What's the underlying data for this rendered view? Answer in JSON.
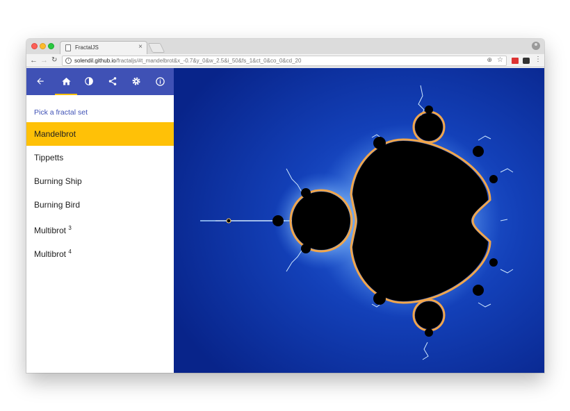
{
  "browser": {
    "tab_title": "FractalJS",
    "tab_close": "×",
    "url_host": "solendil.github.io",
    "url_path": "/fractaljs/#t_mandelbrot&x_-0.7&y_0&w_2.5&i_50&fs_1&ct_0&co_0&cd_20"
  },
  "icons": {
    "back": "arrow-back-icon",
    "home": "home-icon",
    "color": "contrast-icon",
    "share": "share-icon",
    "settings": "gear-icon",
    "about": "info-icon"
  },
  "sidebar": {
    "section_title": "Pick a fractal set",
    "items": [
      {
        "label": "Mandelbrot",
        "sup": "",
        "selected": true
      },
      {
        "label": "Tippetts",
        "sup": "",
        "selected": false
      },
      {
        "label": "Burning Ship",
        "sup": "",
        "selected": false
      },
      {
        "label": "Burning Bird",
        "sup": "",
        "selected": false
      },
      {
        "label": "Multibrot ",
        "sup": "3",
        "selected": false
      },
      {
        "label": "Multibrot ",
        "sup": "4",
        "selected": false
      }
    ]
  },
  "colors": {
    "appbar": "#3f51b5",
    "accent": "#ffc107",
    "fractal_bg": "#0c2d9a"
  }
}
